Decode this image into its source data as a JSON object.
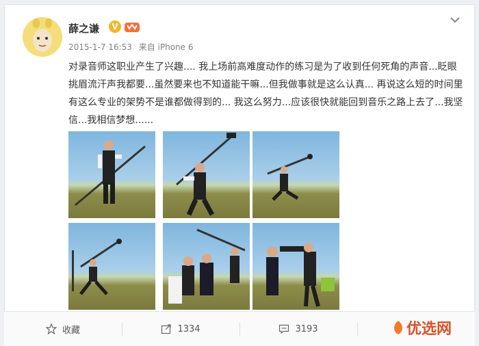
{
  "post": {
    "author": "薛之谦",
    "verified_badge": "V",
    "date": "2015-1-7 16:53",
    "source": "来自 iPhone 6",
    "text": "对录音师这职业产生了兴趣.... 我上场前高难度动作的练习是为了收到任何死角的声音...眨眼挑眉流汗声我都要...虽然要来也不知道能干嘛...但我做事就是这么认真... 再说这么短的时间里有这么专业的架势不是谁都做得到的... 我这么努力...应该很快就能回到音乐之路上去了...我坚信...我相信梦想......",
    "photos": [
      {
        "name": "photo-1"
      },
      {
        "name": "photo-2"
      },
      {
        "name": "photo-3"
      },
      {
        "name": "photo-4"
      },
      {
        "name": "photo-5"
      },
      {
        "name": "photo-6"
      }
    ]
  },
  "actions": {
    "favorite_label": "收藏",
    "repost_count": "1334",
    "comment_count": "3193"
  },
  "watermark": "优选网",
  "icons": {
    "favorite": "star-icon",
    "repost": "repost-icon",
    "comment": "comment-icon",
    "more": "chevron-down-icon"
  }
}
